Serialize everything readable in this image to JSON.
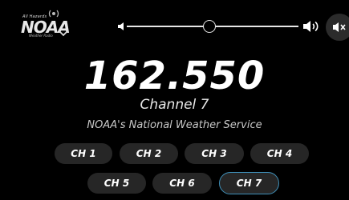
{
  "header": {
    "logo": {
      "top_text": "All Hazards",
      "main_text": "NOAA",
      "bottom_text": "Weather Radio"
    },
    "volume": {
      "level": 0.48,
      "low_icon": "volume-low-icon",
      "high_icon": "volume-high-icon",
      "mute_icon": "mute-icon"
    }
  },
  "main": {
    "frequency": "162.550",
    "channel_label": "Channel 7",
    "service_name": "NOAA's National Weather Service"
  },
  "channels": [
    {
      "label": "CH 1"
    },
    {
      "label": "CH 2"
    },
    {
      "label": "CH 3"
    },
    {
      "label": "CH 4"
    },
    {
      "label": "CH 5"
    },
    {
      "label": "CH 6"
    },
    {
      "label": "CH 7"
    }
  ],
  "selected_channel": "CH 7",
  "colors": {
    "background": "#000000",
    "button": "#262626",
    "active_border": "#3f8fb8",
    "text": "#ffffff"
  }
}
